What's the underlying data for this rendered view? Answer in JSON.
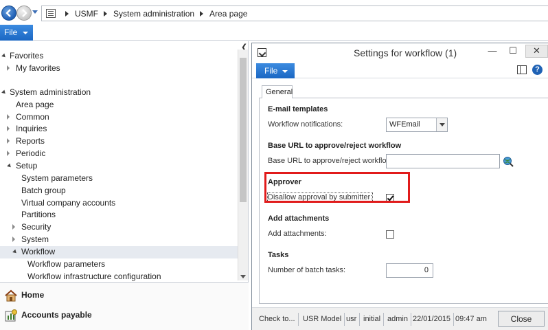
{
  "address_bar": {
    "crumbs": [
      "USMF",
      "System administration",
      "Area page"
    ]
  },
  "ribbon": {
    "file_label": "File"
  },
  "nav": {
    "favorites_header": "Favorites",
    "my_favorites": "My favorites",
    "sysadmin_header": "System administration",
    "items": {
      "area_page": "Area page",
      "common": "Common",
      "inquiries": "Inquiries",
      "reports": "Reports",
      "periodic": "Periodic",
      "setup": "Setup",
      "system_parameters": "System parameters",
      "batch_group": "Batch group",
      "virtual_company_accounts": "Virtual company accounts",
      "partitions": "Partitions",
      "security": "Security",
      "system": "System",
      "workflow": "Workflow",
      "workflow_parameters": "Workflow parameters",
      "workflow_infrastructure_configuration": "Workflow infrastructure configuration"
    },
    "modules": {
      "home": "Home",
      "accounts_payable": "Accounts payable"
    }
  },
  "dialog": {
    "title": "Settings for workflow (1)",
    "file_label": "File",
    "help_glyph": "?",
    "tab_general": "General",
    "email": {
      "section": "E-mail templates",
      "label": "Workflow notifications:",
      "value": "WFEmail"
    },
    "base_url": {
      "section": "Base URL to approve/reject workflow",
      "label": "Base URL to approve/reject workflow:",
      "value": ""
    },
    "approver": {
      "section": "Approver",
      "label": "Disallow approval by submitter:",
      "checked": true
    },
    "attachments": {
      "section": "Add attachments",
      "label": "Add attachments:",
      "checked": false
    },
    "tasks": {
      "section": "Tasks",
      "label": "Number of batch tasks:",
      "value": "0"
    },
    "status": {
      "check_to": "Check to...",
      "model": "USR Model",
      "user": "usr",
      "layer": "initial",
      "role": "admin",
      "date": "22/01/2015",
      "time": "09:47 am",
      "close_label": "Close"
    }
  },
  "colors": {
    "accent_blue": "#1b67c3",
    "highlight_red": "#e11b1b"
  }
}
